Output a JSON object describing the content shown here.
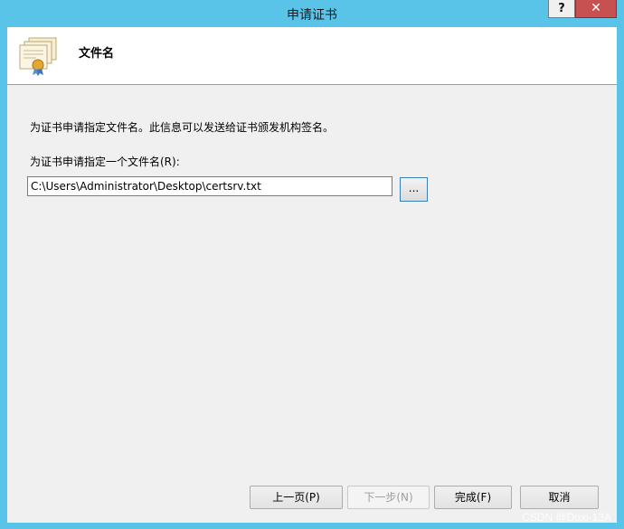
{
  "window": {
    "title": "申请证书",
    "help_label": "?",
    "close_label": "✕"
  },
  "header": {
    "title": "文件名",
    "icon": "certificate-icon"
  },
  "main": {
    "description": "为证书申请指定文件名。此信息可以发送给证书颁发机构签名。",
    "field_label": "为证书申请指定一个文件名(R):",
    "file_path_value": "C:\\Users\\Administrator\\Desktop\\certsrv.txt",
    "browse_label": "..."
  },
  "footer": {
    "prev_label": "上一页(P)",
    "next_label": "下一步(N)",
    "finish_label": "完成(F)",
    "cancel_label": "取消"
  },
  "watermark": "CSDN @Doxi-13A",
  "colors": {
    "titlebar": "#5ac3e8",
    "close_button": "#c75050",
    "client_background": "#f0f0f0"
  }
}
